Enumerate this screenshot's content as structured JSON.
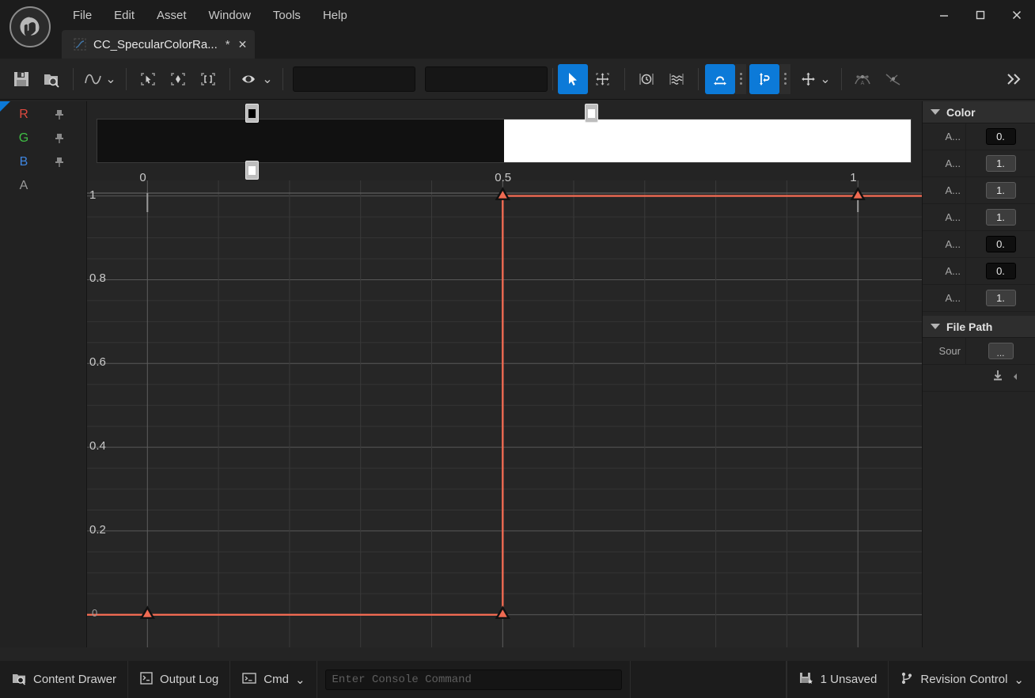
{
  "window": {
    "logo_name": "unreal-engine-logo",
    "menu": [
      "File",
      "Edit",
      "Asset",
      "Window",
      "Tools",
      "Help"
    ],
    "controls": {
      "minimize": "—",
      "maximize": "□",
      "close": "✕"
    }
  },
  "tab": {
    "name": "CC_SpecularColorRa...",
    "dirty": "*",
    "close": "✕"
  },
  "toolbar": {
    "save_icon": "save-icon",
    "browse_icon": "browse-to-asset-icon",
    "curve_icon": "curve-icon",
    "select_all_icon": "frame-select-icon",
    "key_icon": "key-framing-icon",
    "brackets_icon": "brackets-icon",
    "visibility_icon": "visibility-eye-icon",
    "field1_value": "",
    "field2_value": "",
    "cursor_tool": "select-tool-icon",
    "marquee_tool": "marquee-tool-icon",
    "time_snap_icon": "time-snap-icon",
    "curve_snap_icon": "curve-snap-icon",
    "snap_time_icon": "snap-horizontal-icon",
    "snap_value_icon": "snap-vertical-icon",
    "transform_icon": "transform-move-icon",
    "tangent_auto_icon": "tangent-auto-icon",
    "tangent_break_icon": "tangent-break-icon",
    "overflow_icon": "overflow-chevrons-icon",
    "chevron": "⌄"
  },
  "channels": {
    "rows": [
      {
        "label": "R",
        "color": "#e04a3f",
        "pin": "pin-icon"
      },
      {
        "label": "G",
        "color": "#3fbf45",
        "pin": "pin-icon"
      },
      {
        "label": "B",
        "color": "#3f86e0",
        "pin": "pin-icon"
      },
      {
        "label": "A",
        "color": "#9a9a9a",
        "pin": ""
      }
    ]
  },
  "gradient": {
    "stops_top": [
      {
        "position": 0.085,
        "color": "#000000"
      },
      {
        "position": 0.5,
        "color": "#ffffff"
      },
      {
        "position": 0.918,
        "color": "#ffffff"
      }
    ],
    "stops_bottom": [
      {
        "position": 0.085,
        "color": "#ffffff"
      },
      {
        "position": 0.918,
        "color": "#ffffff"
      }
    ],
    "segments": [
      {
        "from": 0.0,
        "to": 0.5,
        "color": "#111111"
      },
      {
        "from": 0.5,
        "to": 1.0,
        "color": "#ffffff"
      }
    ]
  },
  "chart_data": {
    "type": "line",
    "title": "",
    "xlabel": "",
    "ylabel": "",
    "xlim": [
      -0.085,
      1.09
    ],
    "ylim": [
      -0.025,
      1.09
    ],
    "grid": true,
    "legend": false,
    "x_ticks": [
      {
        "value": 0,
        "label": "0"
      },
      {
        "value": 0.5,
        "label": "0.5"
      },
      {
        "value": 1,
        "label": "1"
      }
    ],
    "y_ticks": [
      {
        "value": 0,
        "label": "0"
      },
      {
        "value": 0.2,
        "label": "0.2"
      },
      {
        "value": 0.4,
        "label": "0.4"
      },
      {
        "value": 0.6,
        "label": "0.6"
      },
      {
        "value": 0.8,
        "label": "0.8"
      },
      {
        "value": 1,
        "label": "1"
      }
    ],
    "series": [
      {
        "name": "R",
        "color": "#ef6a52",
        "interpolation": "constant",
        "points": [
          {
            "x": 0.0,
            "y": 0.0
          },
          {
            "x": 0.5,
            "y": 0.0
          },
          {
            "x": 0.5,
            "y": 1.0
          },
          {
            "x": 1.0,
            "y": 1.0
          }
        ],
        "keys": [
          {
            "x": 0.0,
            "y": 0.0
          },
          {
            "x": 0.5,
            "y": 0.0
          },
          {
            "x": 0.5,
            "y": 1.0
          },
          {
            "x": 1.0,
            "y": 1.0
          }
        ]
      }
    ]
  },
  "details": {
    "sections": [
      {
        "title": "Color",
        "icon": "collapse-triangle-icon",
        "rows": [
          {
            "name": "A...",
            "value": "0.",
            "style": "plain"
          },
          {
            "name": "A...",
            "value": "1.",
            "style": "dotted"
          },
          {
            "name": "A...",
            "value": "1.",
            "style": "dotted"
          },
          {
            "name": "A...",
            "value": "1.",
            "style": "dotted"
          },
          {
            "name": "A...",
            "value": "0.",
            "style": "plain"
          },
          {
            "name": "A...",
            "value": "0.",
            "style": "plain"
          },
          {
            "name": "A...",
            "value": "1.",
            "style": "dotted"
          }
        ]
      },
      {
        "title": "File Path",
        "icon": "collapse-triangle-icon",
        "rows": [
          {
            "name": "Sour",
            "value": "...",
            "style": "dots-button"
          }
        ]
      }
    ],
    "import_row": {
      "download_icon": "reimport-icon",
      "arrow_icon": "arrow-icon"
    }
  },
  "statusbar": {
    "content_drawer": "Content Drawer",
    "output_log": "Output Log",
    "cmd": "Cmd",
    "cmd_chevron": "⌄",
    "console_placeholder": "Enter Console Command",
    "unsaved": "1 Unsaved",
    "revision_control": "Revision Control",
    "rc_chevron": "⌄"
  },
  "colors": {
    "accent": "#0c7ad8",
    "curve": "#ef6a52",
    "channel_r": "#e04a3f",
    "channel_g": "#3fbf45",
    "channel_b": "#3f86e0"
  }
}
